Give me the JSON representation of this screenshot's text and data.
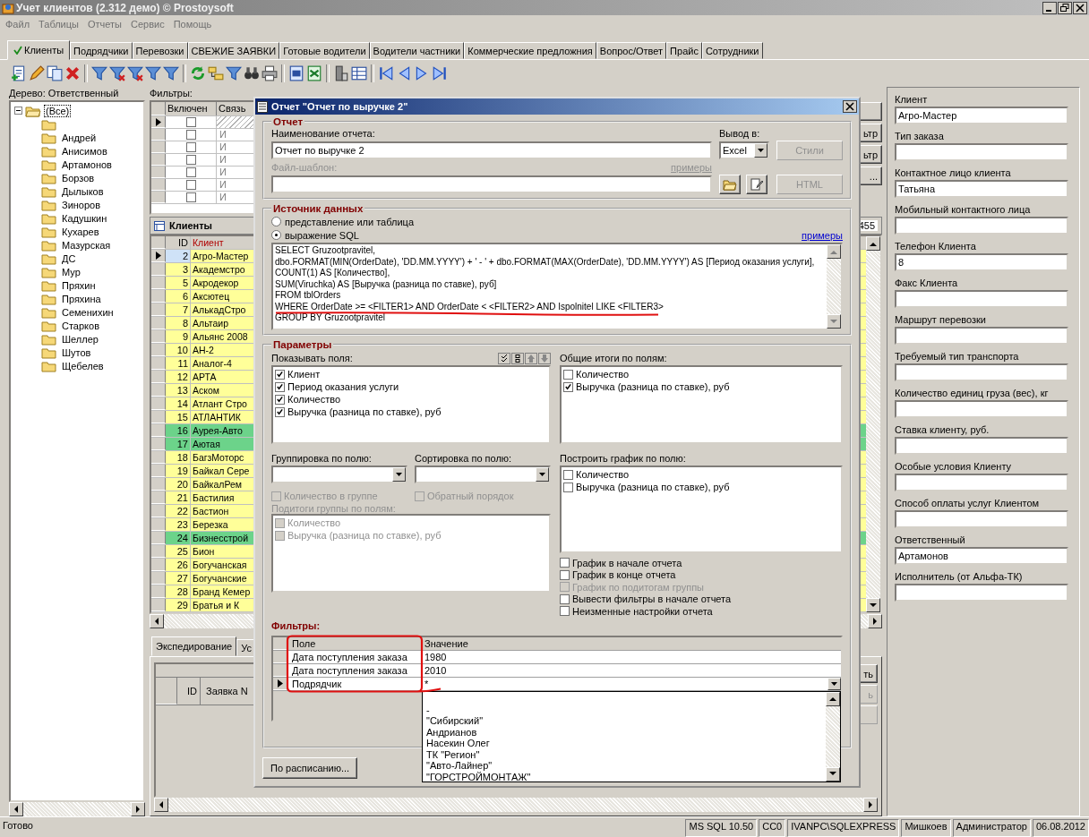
{
  "window": {
    "title": "Учет клиентов (2.312 демо) © Prostoysoft"
  },
  "menu": [
    "Файл",
    "Таблицы",
    "Отчеты",
    "Сервис",
    "Помощь"
  ],
  "tabs": [
    {
      "label": "Клиенты",
      "selected": true
    },
    {
      "label": "Подрядчики",
      "selected": false
    },
    {
      "label": "Перевозки",
      "selected": false
    },
    {
      "label": "СВЕЖИЕ ЗАЯВКИ",
      "selected": false
    },
    {
      "label": "Готовые водители",
      "selected": false
    },
    {
      "label": "Водители частники",
      "selected": false
    },
    {
      "label": "Коммерческие предложния",
      "selected": false
    },
    {
      "label": "Вопрос/Ответ",
      "selected": false
    },
    {
      "label": "Прайс",
      "selected": false
    },
    {
      "label": "Сотрудники",
      "selected": false
    }
  ],
  "tree": {
    "label": "Дерево: Ответственный",
    "root": {
      "label": "(Все)",
      "expanded": true,
      "selected": true,
      "children": [
        {
          "selected": false
        },
        {
          "label": "Андрей",
          "selected": false
        },
        {
          "label": "Анисимов",
          "selected": false
        },
        {
          "label": "Артамонов",
          "selected": false
        },
        {
          "label": "Борзов",
          "selected": false
        },
        {
          "label": "Дылыков",
          "selected": false
        },
        {
          "label": "Зиноров",
          "selected": false
        },
        {
          "label": "Кадушкин",
          "selected": false
        },
        {
          "label": "Кухарев",
          "selected": false
        },
        {
          "label": "Мазурская",
          "selected": false
        },
        {
          "label": "ДС",
          "selected": false
        },
        {
          "label": "Мур",
          "selected": false
        },
        {
          "label": "Пряхин",
          "selected": false
        },
        {
          "label": "Пряхина",
          "selected": false
        },
        {
          "label": "Семенихин",
          "selected": false
        },
        {
          "label": "Старков",
          "selected": false
        },
        {
          "label": "Шеллер",
          "selected": false
        },
        {
          "label": "Шутов",
          "selected": false
        },
        {
          "label": "Щебелев",
          "selected": false
        }
      ]
    }
  },
  "filters_grid": {
    "label": "Фильтры:",
    "columns": [
      "Включен",
      "Связь"
    ],
    "rows": [
      {
        "current": true,
        "checked": false
      },
      {
        "current": false,
        "checked": false,
        "link": "И"
      },
      {
        "current": false,
        "checked": false,
        "link": "И"
      },
      {
        "current": false,
        "checked": false,
        "link": "И"
      },
      {
        "current": false,
        "checked": false,
        "link": "И"
      },
      {
        "current": false,
        "checked": false,
        "link": "И"
      },
      {
        "current": false,
        "checked": false,
        "link": "И"
      }
    ]
  },
  "center_buttons": [
    {
      "disabled": false
    },
    {
      "label": "ьтр",
      "disabled": false
    },
    {
      "label": "ьтр",
      "disabled": false
    },
    {
      "label": "...",
      "disabled": false
    }
  ],
  "clients": {
    "title": "Клиенты",
    "count": "455",
    "columns": [
      "ID",
      "Клиент"
    ],
    "rows": [
      {
        "id": "2",
        "name": "Агро-Мастер",
        "color": "#ffff99",
        "selected": true
      },
      {
        "id": "3",
        "name": "Академстро",
        "color": "#ffff99",
        "selected": false
      },
      {
        "id": "5",
        "name": "Акродекор",
        "color": "#ffff99",
        "selected": false
      },
      {
        "id": "6",
        "name": "Аксютец",
        "color": "#ffff99",
        "selected": false
      },
      {
        "id": "7",
        "name": "АлькадСтро",
        "color": "#ffff99",
        "selected": false
      },
      {
        "id": "8",
        "name": "Альтаир",
        "color": "#ffff99",
        "selected": false
      },
      {
        "id": "9",
        "name": "Альянс 2008",
        "color": "#ffff99",
        "selected": false
      },
      {
        "id": "10",
        "name": "АН-2",
        "color": "#ffff99",
        "selected": false
      },
      {
        "id": "11",
        "name": "Аналог-4",
        "color": "#ffff99",
        "selected": false
      },
      {
        "id": "12",
        "name": "АРТА",
        "color": "#ffff99",
        "selected": false
      },
      {
        "id": "13",
        "name": "Аском",
        "color": "#ffff99",
        "selected": false
      },
      {
        "id": "14",
        "name": "Атлант Стро",
        "color": "#ffff99",
        "selected": false
      },
      {
        "id": "15",
        "name": "АТЛАНТИК",
        "color": "#ffff99",
        "selected": false
      },
      {
        "id": "16",
        "name": "Аурея-Авто",
        "color": "#6cd38a",
        "selected": false
      },
      {
        "id": "17",
        "name": "Аютая",
        "color": "#6cd38a",
        "selected": false
      },
      {
        "id": "18",
        "name": "БагзМоторс",
        "color": "#ffff99",
        "selected": false
      },
      {
        "id": "19",
        "name": "Байкал Сере",
        "color": "#ffff99",
        "selected": false
      },
      {
        "id": "20",
        "name": "БайкалРем",
        "color": "#ffff99",
        "selected": false
      },
      {
        "id": "21",
        "name": "Бастилия",
        "color": "#ffff99",
        "selected": false
      },
      {
        "id": "22",
        "name": "Бастион",
        "color": "#ffff99",
        "selected": false
      },
      {
        "id": "23",
        "name": "Березка",
        "color": "#ffff99",
        "selected": false
      },
      {
        "id": "24",
        "name": "Бизнесстрой",
        "color": "#6cd38a",
        "selected": false
      },
      {
        "id": "25",
        "name": "Бион",
        "color": "#ffff99",
        "selected": false
      },
      {
        "id": "26",
        "name": "Богучанская",
        "color": "#ffff99",
        "selected": false
      },
      {
        "id": "27",
        "name": "Богучанские",
        "color": "#ffff99",
        "selected": false
      },
      {
        "id": "28",
        "name": "Бранд Кемер",
        "color": "#ffff99",
        "selected": false
      },
      {
        "id": "29",
        "name": "Братья и К",
        "color": "#ffff99",
        "selected": false
      }
    ]
  },
  "bottom": {
    "tabs": [
      {
        "label": "Экспедирование",
        "selected": true
      },
      {
        "label": "Ус",
        "selected": false
      }
    ],
    "columns": [
      "ID",
      "Заявка N"
    ],
    "buttons": [
      {
        "label": "ть",
        "disabled": false
      },
      {
        "label": "ь",
        "disabled": true
      },
      {
        "disabled": true
      }
    ]
  },
  "client_card": {
    "fields": [
      {
        "label": "Клиент",
        "value": "Агро-Мастер"
      },
      {
        "label": "Тип заказа"
      },
      {
        "label": "Контактное лицо клиента",
        "value": "Татьяна"
      },
      {
        "label": "Мобильный контактного лица"
      },
      {
        "label": "Телефон Клиента",
        "value": "8"
      },
      {
        "label": "Факс Клиента"
      },
      {
        "label": "Маршрут перевозки"
      },
      {
        "label": "Требуемый тип транспорта"
      },
      {
        "label": "Количество единиц груза (вес), кг"
      },
      {
        "label": "Ставка клиенту, руб."
      },
      {
        "label": "Особые условия Клиенту"
      },
      {
        "label": "Способ оплаты услуг Клиентом"
      },
      {
        "label": "Ответственный",
        "value": "Артамонов"
      },
      {
        "label": "Исполнитель (от Альфа-ТК)"
      }
    ]
  },
  "dialog": {
    "title": "Отчет \"Отчет по выручке 2\"",
    "report": {
      "legend": "Отчет",
      "name_label": "Наименование отчета:",
      "name_value": "Отчет по выручке 2",
      "output_label": "Вывод в:",
      "output_value": "Excel",
      "styles_button": {
        "label": "Стили",
        "disabled": true
      },
      "template_label": "Файл-шаблон:",
      "template_disabled": true,
      "examples_link": "примеры",
      "html_button": {
        "label": "HTML",
        "disabled": true
      }
    },
    "source": {
      "legend": "Источник данных",
      "options": [
        {
          "label": "представление или таблица",
          "selected": false
        },
        {
          "label": "выражение SQL",
          "selected": true
        }
      ],
      "examples_link": "примеры",
      "sql": [
        "SELECT Gruzootpravitel,",
        "dbo.FORMAT(MIN(OrderDate), 'DD.MM.YYYY') + ' - ' + dbo.FORMAT(MAX(OrderDate), 'DD.MM.YYYY') AS [Период оказания услуги],",
        "COUNT(1) AS [Количество],",
        "SUM(Viruchka) AS [Выручка (разница по ставке), руб]",
        "FROM tblOrders",
        "WHERE OrderDate >= <FILTER1> AND OrderDate < <FILTER2> AND Ispolnitel LIKE <FILTER3>",
        "GROUP BY Gruzootpravitel"
      ]
    },
    "params": {
      "legend": "Параметры",
      "show_fields": {
        "label": "Показывать поля:",
        "items": [
          {
            "label": "Клиент",
            "checked": true
          },
          {
            "label": "Период оказания услуги",
            "checked": true
          },
          {
            "label": "Количество",
            "checked": true
          },
          {
            "label": "Выручка (разница по ставке), руб",
            "checked": true
          }
        ]
      },
      "totals": {
        "label": "Общие итоги по полям:",
        "items": [
          {
            "label": "Количество",
            "checked": false
          },
          {
            "label": "Выручка (разница по ставке), руб",
            "checked": true
          }
        ]
      },
      "group_by": {
        "label": "Группировка по полю:"
      },
      "sort_by": {
        "label": "Сортировка по полю:"
      },
      "group_count": {
        "label": "Количество в группе",
        "checked": false,
        "disabled": true
      },
      "reverse_order": {
        "label": "Обратный порядок",
        "checked": false,
        "disabled": true
      },
      "subtotals": {
        "label": "Подитоги группы по полям:",
        "disabled": true,
        "items": [
          {
            "label": "Количество",
            "checked": false
          },
          {
            "label": "Выручка (разница по ставке), руб",
            "checked": false
          }
        ]
      },
      "chart_by": {
        "label": "Построить график по полю:",
        "items": [
          {
            "label": "Количество",
            "checked": false
          },
          {
            "label": "Выручка (разница по ставке), руб",
            "checked": false
          }
        ]
      },
      "chart_options": [
        {
          "label": "График в начале отчета",
          "checked": false,
          "disabled": false
        },
        {
          "label": "График в конце отчета",
          "checked": false,
          "disabled": false
        },
        {
          "label": "График по подитогам группы",
          "checked": false,
          "disabled": true
        },
        {
          "label": "Вывести фильтры в начале отчета",
          "checked": false,
          "disabled": false
        },
        {
          "label": "Неизменные настройки отчета",
          "checked": false,
          "disabled": false
        }
      ]
    },
    "filters": {
      "label": "Фильтры:",
      "columns": [
        "Поле",
        "Значение"
      ],
      "rows": [
        {
          "field": "Дата поступления заказа",
          "value": "1980",
          "current": false
        },
        {
          "field": "Дата поступления заказа",
          "value": "2010",
          "current": false
        },
        {
          "field": "Подрядчик",
          "value": "*",
          "current": true
        }
      ],
      "dropdown": [
        "-",
        "\"Сибирский\"",
        "Андрианов",
        "Насекин Олег",
        "ТК \"Регион\"",
        "\"Авто-Лайнер\"",
        "\"ГОРСТРОЙМОНТАЖ\""
      ]
    },
    "schedule_button": "По расписанию..."
  },
  "status_bar": [
    "Готово",
    "MS SQL 10.50",
    "CC0",
    "IVANPC\\SQLEXPRESS",
    "Мишкоев",
    "Администратор",
    "06.08.2012"
  ]
}
